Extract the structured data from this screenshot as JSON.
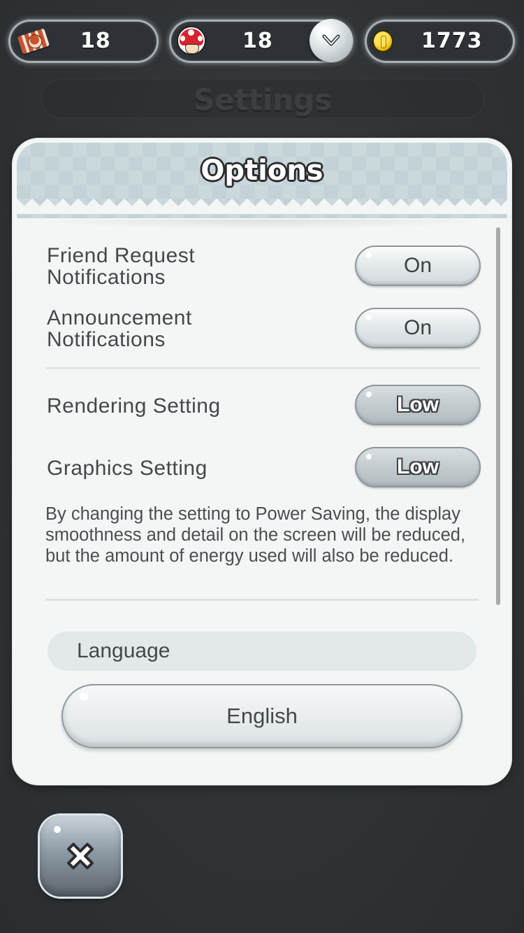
{
  "top_bar": {
    "tickets": {
      "icon": "toad-rally-ticket-icon",
      "value": "18"
    },
    "toads": {
      "icon": "toad-icon",
      "value": "18",
      "dropdown_icon": "chevron-down-icon"
    },
    "coins": {
      "icon": "coin-icon",
      "value": "1773"
    }
  },
  "background": {
    "screen_title": "Settings"
  },
  "dialog": {
    "title": "Options",
    "rows": [
      {
        "label": "Friend Request Notifications",
        "value": "On"
      },
      {
        "label": "Announcement Notifications",
        "value": "On"
      },
      {
        "label": "Rendering Setting",
        "value": "Low"
      },
      {
        "label": "Graphics Setting",
        "value": "Low"
      }
    ],
    "description": "By changing the setting to Power Saving, the display smoothness and detail on the screen will be reduced, but the amount of energy used will also be reduced.",
    "language": {
      "label": "Language",
      "value": "English"
    }
  },
  "close_button": {
    "icon": "close-icon"
  },
  "colors": {
    "background": "#2f3234",
    "dialog": "#f4f6f6",
    "header": "#cbd9dd",
    "text": "#44484b"
  }
}
